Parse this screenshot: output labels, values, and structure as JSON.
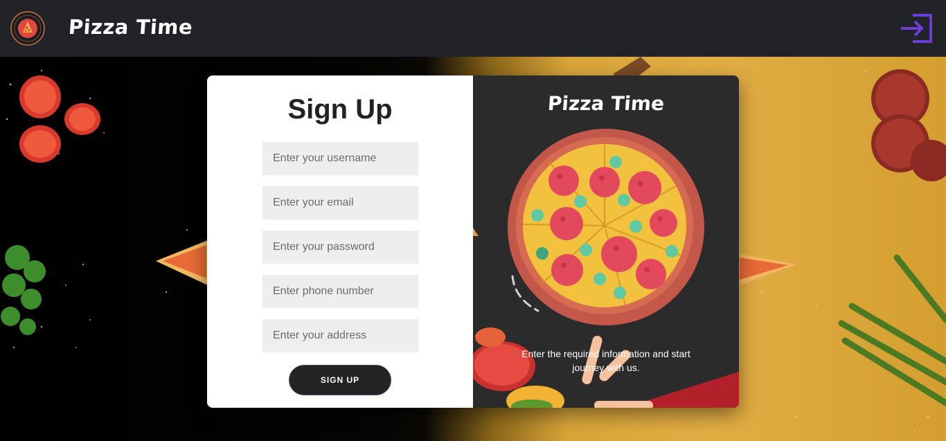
{
  "header": {
    "brand": "Pizza Time",
    "logo_icon": "pizza-logo-icon",
    "login_icon": "sign-in-icon",
    "accent": "#6b3fd6"
  },
  "signup": {
    "title": "Sign Up",
    "fields": {
      "username": {
        "placeholder": "Enter your username",
        "value": ""
      },
      "email": {
        "placeholder": "Enter your email",
        "value": ""
      },
      "password": {
        "placeholder": "Enter your password",
        "value": ""
      },
      "phone": {
        "placeholder": "Enter phone number",
        "value": ""
      },
      "address": {
        "placeholder": "Enter your address",
        "value": ""
      }
    },
    "button_label": "SIGN UP"
  },
  "info": {
    "title": "Pizza Time",
    "message": "Enter the required information and start journey with us."
  },
  "colors": {
    "header_bg": "#212328",
    "info_panel_bg": "#2b2b2b",
    "button_bg": "#232323",
    "field_bg": "#eeeeee"
  }
}
